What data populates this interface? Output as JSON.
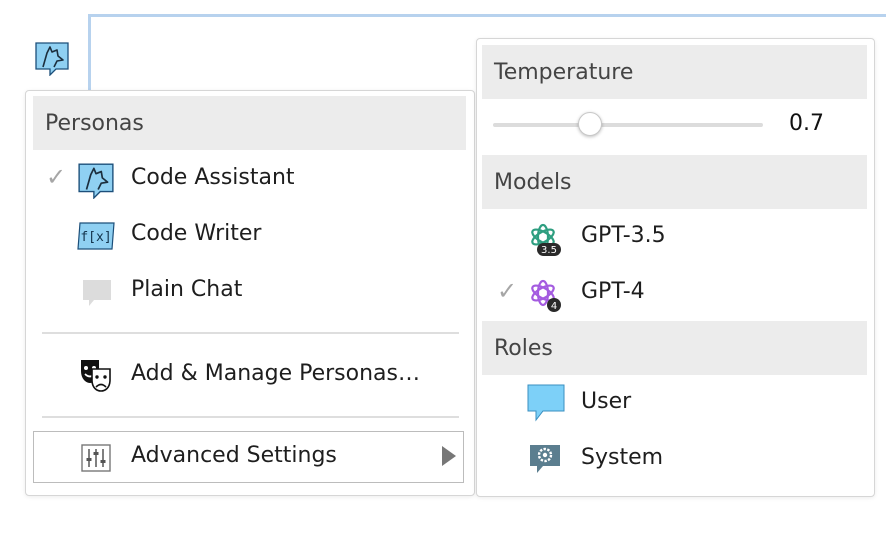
{
  "personas_menu": {
    "header": "Personas",
    "items": [
      {
        "label": "Code Assistant",
        "checked": true
      },
      {
        "label": "Code Writer",
        "checked": false
      },
      {
        "label": "Plain Chat",
        "checked": false
      }
    ],
    "manage_label": "Add & Manage Personas…",
    "advanced_label": "Advanced Settings",
    "check_glyph": "✓"
  },
  "settings_menu": {
    "temperature_header": "Temperature",
    "temperature_value": "0.7",
    "temperature_fraction": 0.36,
    "models_header": "Models",
    "models": [
      {
        "label": "GPT-3.5",
        "badge": "3.5",
        "checked": false,
        "color": "#2e9e80"
      },
      {
        "label": "GPT-4",
        "badge": "4",
        "checked": true,
        "color": "#a45be0"
      }
    ],
    "roles_header": "Roles",
    "roles": [
      {
        "label": "User"
      },
      {
        "label": "System"
      }
    ]
  },
  "colors": {
    "persona_icon_fill": "#8fd0f2",
    "persona_icon_stroke": "#1c4f7a",
    "chat_bubble_blue": "#7dd0f8",
    "gear_icon": "#5b7e8f",
    "header_bg": "#ececec"
  },
  "icons": {
    "app": "fox-persona-icon",
    "code_assistant": "fox-persona-icon",
    "code_writer": "function-fx-icon",
    "plain_chat": "chat-bubble-icon",
    "manage": "theater-masks-icon",
    "advanced": "sliders-icon",
    "gpt35": "openai-logo-icon",
    "gpt4": "openai-logo-icon",
    "user": "chat-bubble-icon",
    "system": "gear-icon"
  }
}
